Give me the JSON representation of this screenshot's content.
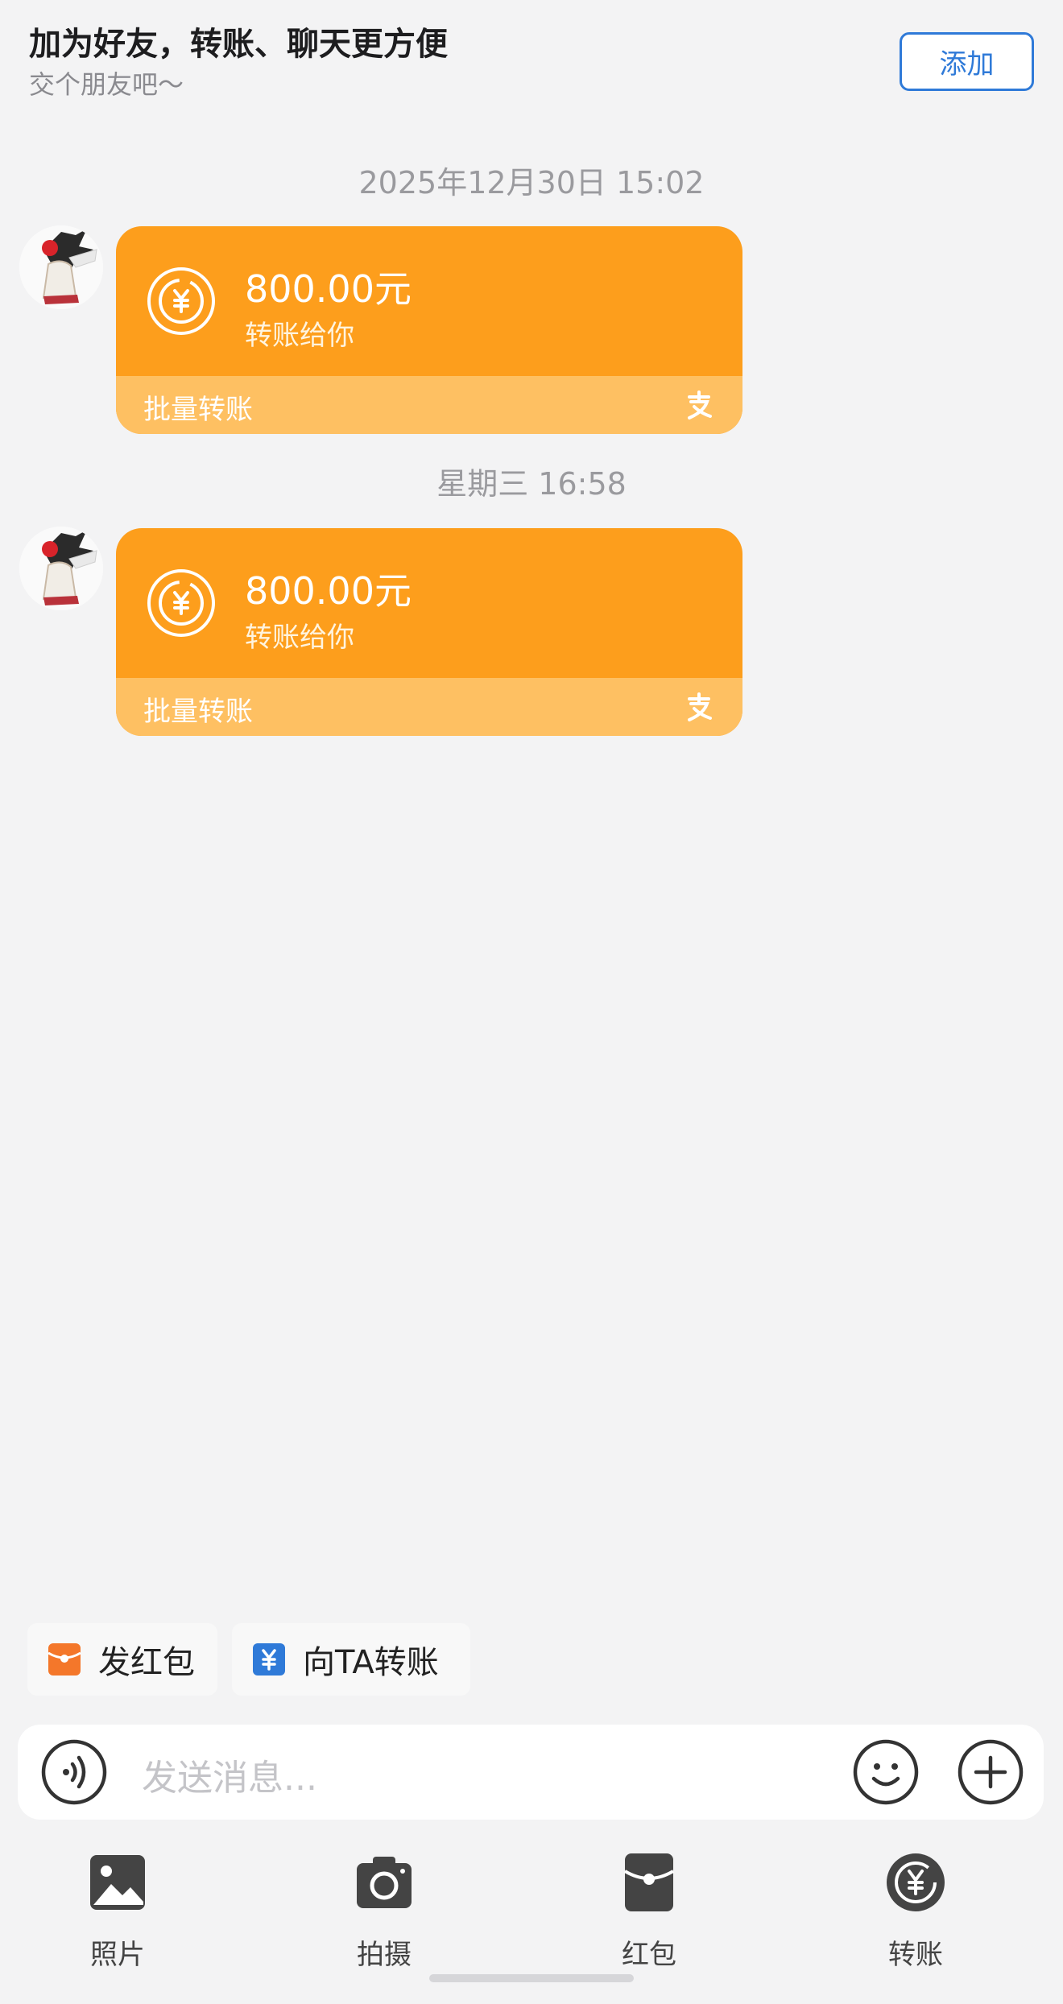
{
  "header": {
    "title": "加为好友，转账、聊天更方便",
    "subtitle": "交个朋友吧～",
    "add_label": "添加"
  },
  "messages": [
    {
      "timestamp": "2025年12月30日 15:02",
      "amount": "800.00元",
      "desc": "转账给你",
      "footer": "批量转账"
    },
    {
      "timestamp": "星期三 16:58",
      "amount": "800.00元",
      "desc": "转账给你",
      "footer": "批量转账"
    }
  ],
  "quick_actions": [
    {
      "label": "发红包",
      "icon": "red-envelope-icon",
      "color": "#f4772a"
    },
    {
      "label": "向TA转账",
      "icon": "transfer-icon",
      "color": "#2f7ad8"
    }
  ],
  "input": {
    "placeholder": "发送消息..."
  },
  "panel": [
    {
      "label": "照片",
      "icon": "photo-icon"
    },
    {
      "label": "拍摄",
      "icon": "camera-icon"
    },
    {
      "label": "红包",
      "icon": "red-packet-icon"
    },
    {
      "label": "转账",
      "icon": "transfer-icon"
    }
  ],
  "colors": {
    "card_orange": "#fd9e1c",
    "card_footer": "#fec062",
    "accent_blue": "#2f7ad8"
  }
}
